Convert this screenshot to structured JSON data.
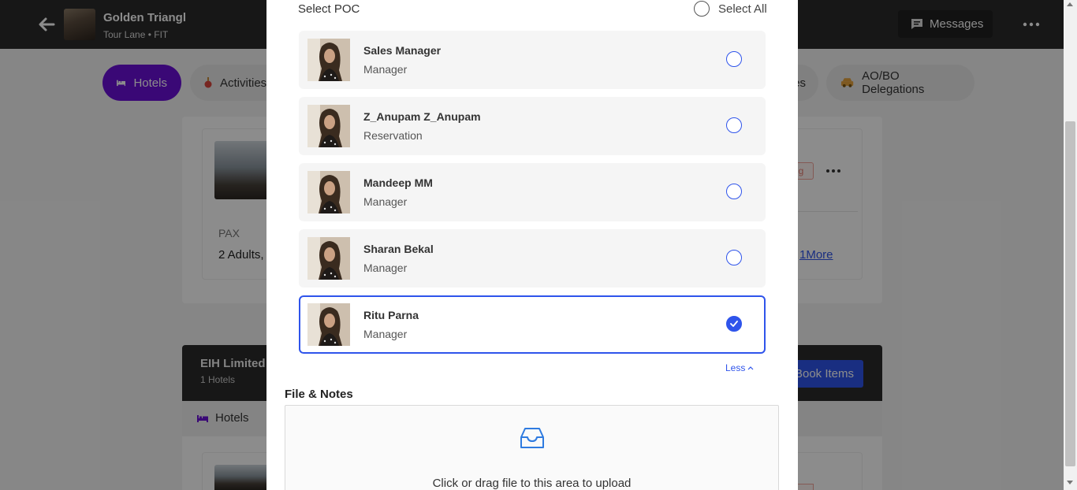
{
  "header": {
    "trip_title": "Golden Triangl",
    "trip_subtitle": "Tour Lane • FIT",
    "messages_label": "Messages",
    "icons": {
      "back": "arrow-left-icon",
      "messages": "chat-icon",
      "more": "more-dots-icon"
    }
  },
  "tabs": [
    {
      "label": "Hotels",
      "icon": "bed-icon",
      "active": true
    },
    {
      "label": "Activities",
      "icon": "activity-icon",
      "active": false
    },
    {
      "label": "es",
      "icon": "",
      "active": false
    },
    {
      "label": "AO/BO Delegations",
      "icon": "car-icon",
      "active": false
    }
  ],
  "background_card": {
    "pax_label": "PAX",
    "pax_value": "2 Adults,",
    "status_fragment": "ng",
    "more_link": "1More"
  },
  "supplier_section": {
    "title": "EIH Limited",
    "subtitle": "1 Hotels",
    "book_button": "Book Items",
    "sub_tab_label": "Hotels"
  },
  "modal": {
    "poc_heading": "Select POC",
    "select_all_label": "Select All",
    "poc_list": [
      {
        "name": "Sales Manager",
        "role": "Manager",
        "selected": false
      },
      {
        "name": "Z_Anupam Z_Anupam",
        "role": "Reservation",
        "selected": false
      },
      {
        "name": "Mandeep MM",
        "role": "Manager",
        "selected": false
      },
      {
        "name": "Sharan Bekal",
        "role": "Manager",
        "selected": false
      },
      {
        "name": "Ritu Parna",
        "role": "Manager",
        "selected": true
      }
    ],
    "less_label": "Less",
    "files_heading": "File & Notes",
    "upload_text": "Click or drag file to this area to upload",
    "upload_icon": "inbox-icon"
  },
  "colors": {
    "accent_purple": "#6a10d8",
    "accent_blue": "#2f54eb",
    "header_dark": "#2b2b2b"
  }
}
